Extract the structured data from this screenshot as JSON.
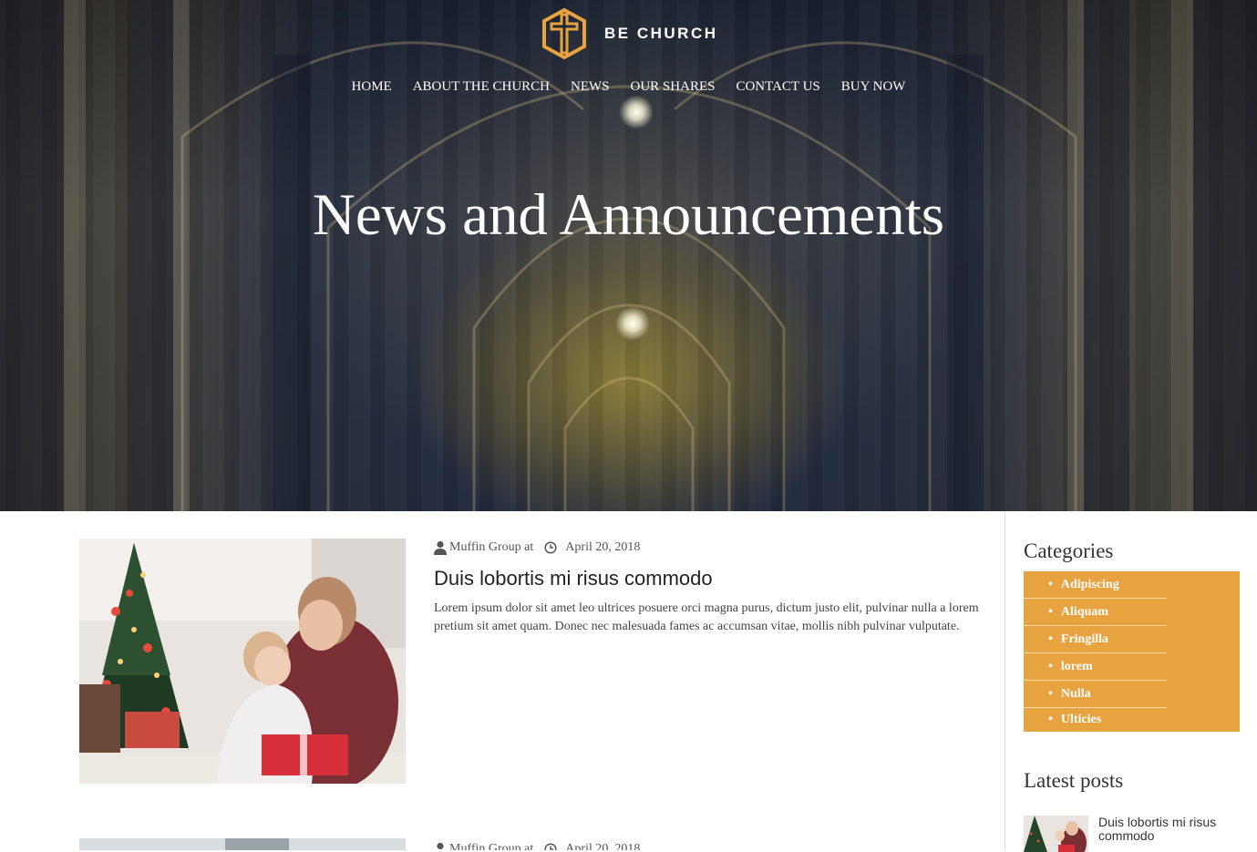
{
  "brand": {
    "name": "BE CHURCH",
    "accent": "#e8a341"
  },
  "nav": {
    "items": [
      "HOME",
      "ABOUT THE CHURCH",
      "NEWS",
      "OUR SHARES",
      "CONTACT US",
      "BUY NOW"
    ]
  },
  "hero": {
    "title": "News and Announcements"
  },
  "posts": [
    {
      "author": "Muffin Group at",
      "date": "April 20, 2018",
      "title": "Duis lobortis mi risus commodo",
      "excerpt": "Lorem ipsum dolor sit amet leo ultrices posuere orci magna purus, dictum justo elit, pulvinar nulla a lorem pretium sit amet quam. Donec nec malesuada fames ac accumsan vitae, mollis nibh pulvinar vulputate."
    },
    {
      "author": "Muffin Group at",
      "date": "April 20, 2018"
    }
  ],
  "sidebar": {
    "categories_title": "Categories",
    "categories": [
      "Adipiscing",
      "Aliquam",
      "Fringilla",
      "lorem",
      "Nulla",
      "Ulticies"
    ],
    "latest_title": "Latest posts",
    "latest": [
      {
        "title": "Duis lobortis mi risus commodo"
      }
    ]
  }
}
